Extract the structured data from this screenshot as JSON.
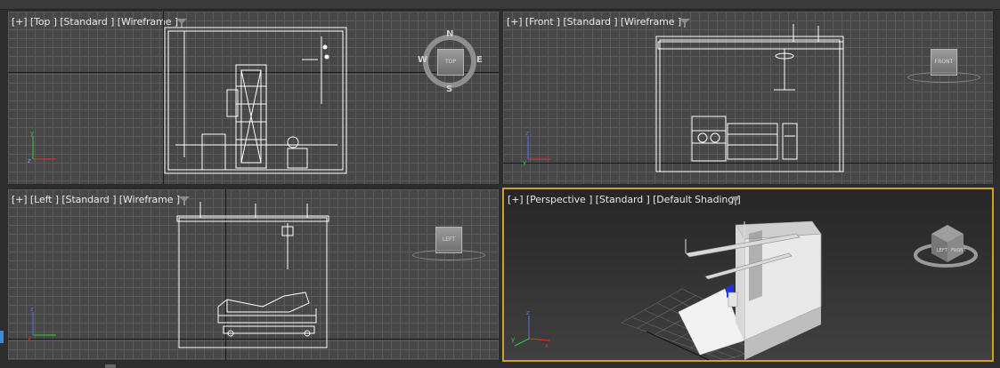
{
  "viewports": {
    "top": {
      "label": "[+] [Top ] [Standard ] [Wireframe ]"
    },
    "front": {
      "label": "[+] [Front ] [Standard ] [Wireframe ]"
    },
    "left": {
      "label": "[+] [Left ] [Standard ] [Wireframe ]"
    },
    "perspective": {
      "label": "[+] [Perspective ] [Standard ] [Default Shading ]"
    }
  },
  "compass": {
    "n": "N",
    "s": "S",
    "e": "E",
    "w": "W",
    "face": "TOP"
  },
  "viewcube": {
    "front": "FRONT",
    "left": "LEFT"
  },
  "colors": {
    "active_border": "#c9a227",
    "grid": "#5a5a5a",
    "viewport_bg": "#474747",
    "wire": "#ffffff"
  },
  "icons": [
    "filter-icon",
    "viewcube-icon",
    "compass-icon",
    "axis-triad-icon"
  ]
}
